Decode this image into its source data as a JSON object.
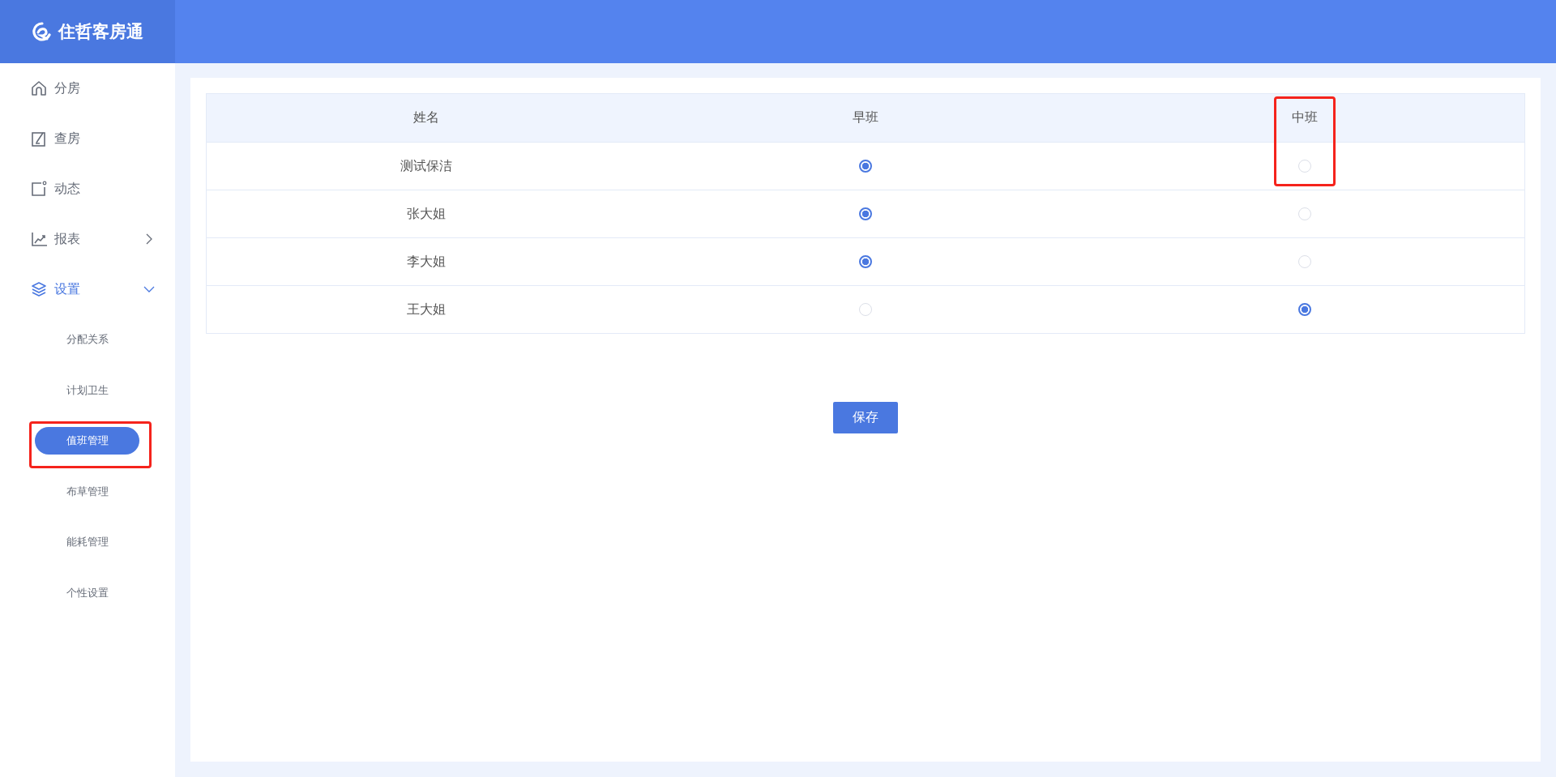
{
  "app": {
    "title": "住哲客房通"
  },
  "sidebar": {
    "items": [
      {
        "label": "分房",
        "selected": false
      },
      {
        "label": "查房",
        "selected": false
      },
      {
        "label": "动态",
        "selected": false
      },
      {
        "label": "报表",
        "expanded": false,
        "selected": false
      },
      {
        "label": "设置",
        "expanded": true,
        "selected": true,
        "children": [
          {
            "label": "分配关系",
            "selected": false
          },
          {
            "label": "计划卫生",
            "selected": false
          },
          {
            "label": "值班管理",
            "selected": true,
            "highlighted": true
          },
          {
            "label": "布草管理",
            "selected": false
          },
          {
            "label": "能耗管理",
            "selected": false
          },
          {
            "label": "个性设置",
            "selected": false
          }
        ]
      }
    ]
  },
  "table": {
    "columns": [
      {
        "label": "姓名"
      },
      {
        "label": "早班"
      },
      {
        "label": "中班",
        "highlighted": true
      }
    ],
    "rows": [
      {
        "name": "测试保洁",
        "shifts": [
          {
            "selected": true
          },
          {
            "selected": false
          }
        ]
      },
      {
        "name": "张大姐",
        "shifts": [
          {
            "selected": true
          },
          {
            "selected": false
          }
        ]
      },
      {
        "name": "李大姐",
        "shifts": [
          {
            "selected": true
          },
          {
            "selected": false
          }
        ]
      },
      {
        "name": "王大姐",
        "shifts": [
          {
            "selected": false
          },
          {
            "selected": true
          }
        ]
      }
    ]
  },
  "save_button": {
    "label": "保存"
  }
}
